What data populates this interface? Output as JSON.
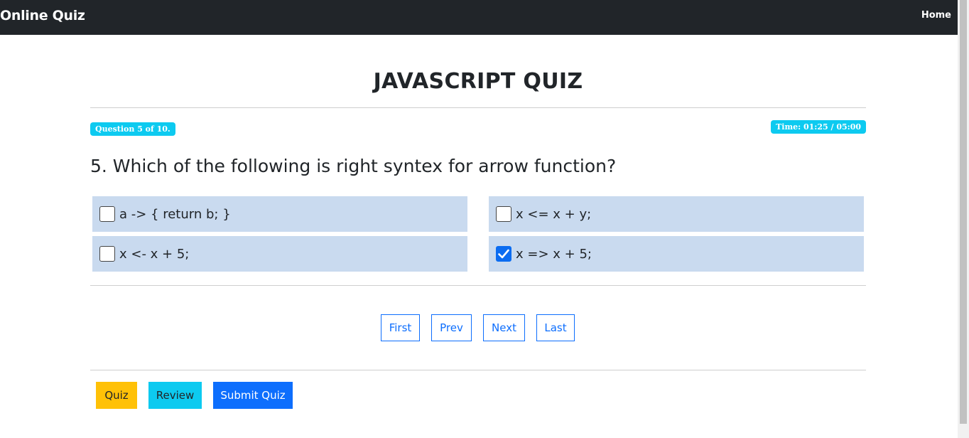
{
  "navbar": {
    "brand": "Online Quiz",
    "home_link": "Home"
  },
  "quiz": {
    "title": "JAVASCRIPT QUIZ",
    "question_badge": "Question 5 of 10.",
    "timer_badge": "Time: 01:25 / 05:00",
    "question_text": "5. Which of the following is right syntex for arrow function?",
    "options": [
      {
        "label": "a -> { return b; }",
        "checked": false
      },
      {
        "label": "x <= x + y;",
        "checked": false
      },
      {
        "label": "x <- x + 5;",
        "checked": false
      },
      {
        "label": "x => x + 5;",
        "checked": true
      }
    ]
  },
  "pager": {
    "first": "First",
    "prev": "Prev",
    "next": "Next",
    "last": "Last"
  },
  "actions": {
    "quiz": "Quiz",
    "review": "Review",
    "submit": "Submit Quiz"
  },
  "colors": {
    "navbar_bg": "#212529",
    "badge_info": "#0dcaf0",
    "option_bg": "#c9daef",
    "primary": "#0d6efd",
    "warning": "#ffc107",
    "info": "#0dcaf0",
    "checkbox_checked": "#0b6cf1"
  }
}
